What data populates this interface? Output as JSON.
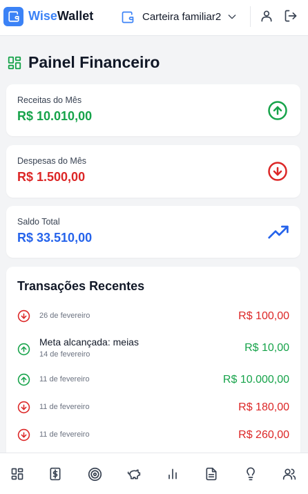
{
  "header": {
    "brand_part1": "Wise",
    "brand_part2": "Wallet",
    "wallet_name": "Carteira familiar2",
    "accent_color": "#3b82f6"
  },
  "page": {
    "title": "Painel Financeiro"
  },
  "summary": {
    "income": {
      "label": "Receitas do Mês",
      "value": "R$ 10.010,00",
      "icon": "arrow-up-circle-icon",
      "color": "#16a34a"
    },
    "expense": {
      "label": "Despesas do Mês",
      "value": "R$ 1.500,00",
      "icon": "arrow-down-circle-icon",
      "color": "#dc2626"
    },
    "balance": {
      "label": "Saldo Total",
      "value": "R$ 33.510,00",
      "icon": "trending-up-icon",
      "color": "#2563eb"
    }
  },
  "transactions": {
    "title": "Transações Recentes",
    "items": [
      {
        "type": "out",
        "description": "",
        "date": "26 de fevereiro",
        "amount": "R$ 100,00"
      },
      {
        "type": "in",
        "description": "Meta alcançada: meias",
        "date": "14 de fevereiro",
        "amount": "R$ 10,00"
      },
      {
        "type": "in",
        "description": "",
        "date": "11 de fevereiro",
        "amount": "R$ 10.000,00"
      },
      {
        "type": "out",
        "description": "",
        "date": "11 de fevereiro",
        "amount": "R$ 180,00"
      },
      {
        "type": "out",
        "description": "",
        "date": "11 de fevereiro",
        "amount": "R$ 260,00"
      }
    ]
  },
  "bottom_nav": {
    "items": [
      "dashboard-icon",
      "dollar-receipt-icon",
      "target-icon",
      "piggy-bank-icon",
      "bar-chart-icon",
      "document-icon",
      "lightbulb-icon",
      "users-icon"
    ]
  }
}
